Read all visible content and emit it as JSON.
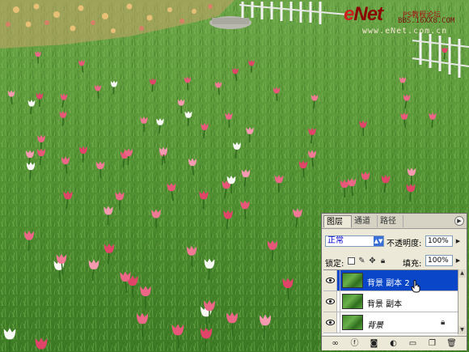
{
  "watermark": {
    "brand_e": "e",
    "brand_rest": "Net",
    "line1": "PS教程论坛",
    "line2": "BBS.16XX8.COM",
    "site": "www.eNet.com.cn"
  },
  "layers_panel": {
    "tabs": [
      {
        "label": "图层",
        "active": true
      },
      {
        "label": "通道",
        "active": false
      },
      {
        "label": "路径",
        "active": false
      }
    ],
    "menu_button": "▶",
    "blend_mode": "正常",
    "opacity_label": "不透明度:",
    "opacity_value": "100%",
    "lock_label": "锁定:",
    "fill_label": "填充:",
    "fill_value": "100%",
    "layers": [
      {
        "name": "背景 副本 2",
        "selected": true,
        "locked": false,
        "italic": false
      },
      {
        "name": "背景 副本",
        "selected": false,
        "locked": false,
        "italic": false
      },
      {
        "name": "背景",
        "selected": false,
        "locked": true,
        "italic": true
      }
    ],
    "bottom_icons": [
      "link-icon",
      "layer-style-icon",
      "layer-mask-icon",
      "adjustment-layer-icon",
      "new-group-icon",
      "new-layer-icon",
      "trash-icon"
    ]
  },
  "colors": {
    "selection": "#0a46c8",
    "panel_bg": "#ece9d8",
    "watermark_red": "#cc1f1f"
  }
}
